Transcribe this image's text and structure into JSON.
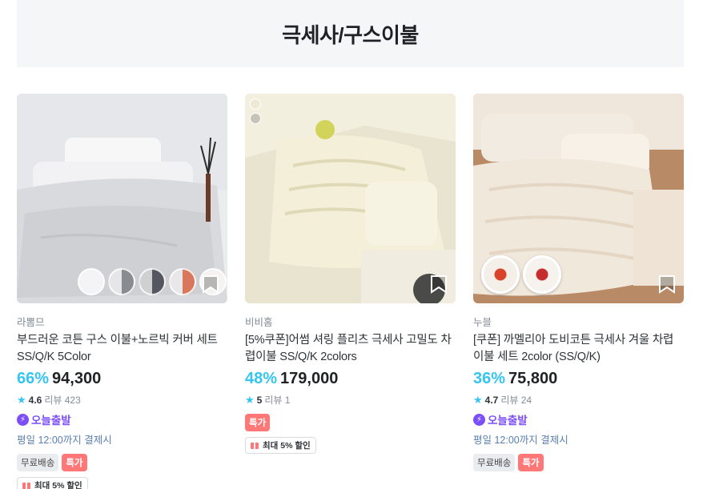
{
  "section": {
    "title": "극세사/구스이불"
  },
  "products": [
    {
      "brand": "라뽐므",
      "title": "부드러운 코튼 구스 이불+노르빅 커버 세트 SS/Q/K 5Color",
      "discount": "66%",
      "price": "94,300",
      "rating": "4.6",
      "review": "리뷰 423",
      "today_label": "오늘출발",
      "today_note": "평일 12:00까지 결제시",
      "tags": [
        "무료배송",
        "특가"
      ],
      "coupon": "최대 5% 할인"
    },
    {
      "brand": "비비홈",
      "title": "[5%쿠폰]어썸 셔링 플리츠 극세사 고밀도 차렵이불 SS/Q/K 2colors",
      "discount": "48%",
      "price": "179,000",
      "rating": "5",
      "review": "리뷰 1",
      "tags": [
        "특가"
      ],
      "coupon": "최대 5% 할인"
    },
    {
      "brand": "누블",
      "title": "[쿠폰] 까멜리아 도비코튼 극세사 겨울 차렵이불 세트 2color (SS/Q/K)",
      "discount": "36%",
      "price": "75,800",
      "rating": "4.7",
      "review": "리뷰 24",
      "today_label": "오늘출발",
      "today_note": "평일 12:00까지 결제시",
      "tags": [
        "무료배송",
        "특가"
      ]
    }
  ],
  "colors": {
    "accent": "#35c5f0",
    "today": "#7b4ef9",
    "sale_tag": "#ff7777"
  }
}
